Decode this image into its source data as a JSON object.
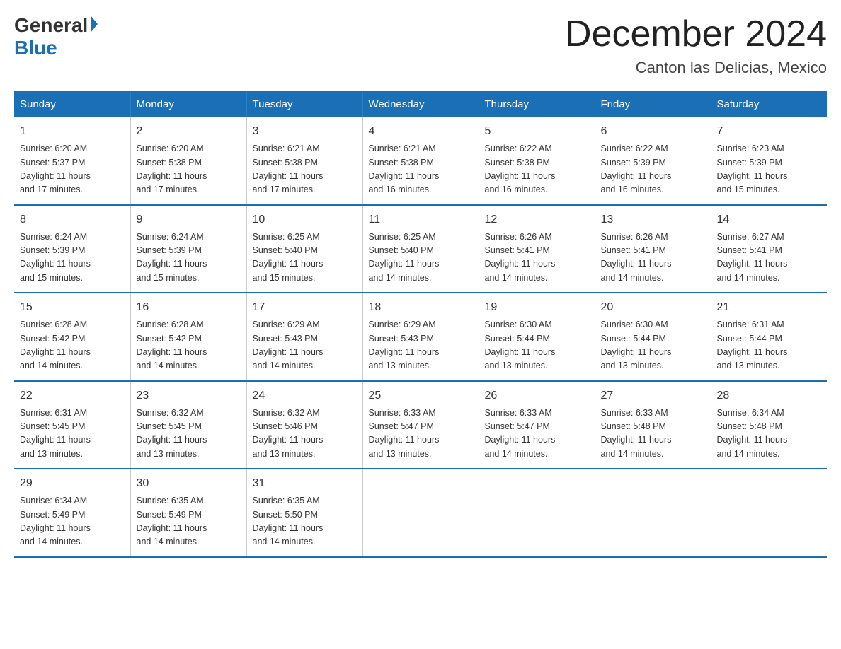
{
  "logo": {
    "general": "General",
    "blue": "Blue"
  },
  "title": "December 2024",
  "location": "Canton las Delicias, Mexico",
  "headers": [
    "Sunday",
    "Monday",
    "Tuesday",
    "Wednesday",
    "Thursday",
    "Friday",
    "Saturday"
  ],
  "weeks": [
    [
      {
        "day": "1",
        "sunrise": "6:20 AM",
        "sunset": "5:37 PM",
        "daylight": "11 hours and 17 minutes."
      },
      {
        "day": "2",
        "sunrise": "6:20 AM",
        "sunset": "5:38 PM",
        "daylight": "11 hours and 17 minutes."
      },
      {
        "day": "3",
        "sunrise": "6:21 AM",
        "sunset": "5:38 PM",
        "daylight": "11 hours and 17 minutes."
      },
      {
        "day": "4",
        "sunrise": "6:21 AM",
        "sunset": "5:38 PM",
        "daylight": "11 hours and 16 minutes."
      },
      {
        "day": "5",
        "sunrise": "6:22 AM",
        "sunset": "5:38 PM",
        "daylight": "11 hours and 16 minutes."
      },
      {
        "day": "6",
        "sunrise": "6:22 AM",
        "sunset": "5:39 PM",
        "daylight": "11 hours and 16 minutes."
      },
      {
        "day": "7",
        "sunrise": "6:23 AM",
        "sunset": "5:39 PM",
        "daylight": "11 hours and 15 minutes."
      }
    ],
    [
      {
        "day": "8",
        "sunrise": "6:24 AM",
        "sunset": "5:39 PM",
        "daylight": "11 hours and 15 minutes."
      },
      {
        "day": "9",
        "sunrise": "6:24 AM",
        "sunset": "5:39 PM",
        "daylight": "11 hours and 15 minutes."
      },
      {
        "day": "10",
        "sunrise": "6:25 AM",
        "sunset": "5:40 PM",
        "daylight": "11 hours and 15 minutes."
      },
      {
        "day": "11",
        "sunrise": "6:25 AM",
        "sunset": "5:40 PM",
        "daylight": "11 hours and 14 minutes."
      },
      {
        "day": "12",
        "sunrise": "6:26 AM",
        "sunset": "5:41 PM",
        "daylight": "11 hours and 14 minutes."
      },
      {
        "day": "13",
        "sunrise": "6:26 AM",
        "sunset": "5:41 PM",
        "daylight": "11 hours and 14 minutes."
      },
      {
        "day": "14",
        "sunrise": "6:27 AM",
        "sunset": "5:41 PM",
        "daylight": "11 hours and 14 minutes."
      }
    ],
    [
      {
        "day": "15",
        "sunrise": "6:28 AM",
        "sunset": "5:42 PM",
        "daylight": "11 hours and 14 minutes."
      },
      {
        "day": "16",
        "sunrise": "6:28 AM",
        "sunset": "5:42 PM",
        "daylight": "11 hours and 14 minutes."
      },
      {
        "day": "17",
        "sunrise": "6:29 AM",
        "sunset": "5:43 PM",
        "daylight": "11 hours and 14 minutes."
      },
      {
        "day": "18",
        "sunrise": "6:29 AM",
        "sunset": "5:43 PM",
        "daylight": "11 hours and 13 minutes."
      },
      {
        "day": "19",
        "sunrise": "6:30 AM",
        "sunset": "5:44 PM",
        "daylight": "11 hours and 13 minutes."
      },
      {
        "day": "20",
        "sunrise": "6:30 AM",
        "sunset": "5:44 PM",
        "daylight": "11 hours and 13 minutes."
      },
      {
        "day": "21",
        "sunrise": "6:31 AM",
        "sunset": "5:44 PM",
        "daylight": "11 hours and 13 minutes."
      }
    ],
    [
      {
        "day": "22",
        "sunrise": "6:31 AM",
        "sunset": "5:45 PM",
        "daylight": "11 hours and 13 minutes."
      },
      {
        "day": "23",
        "sunrise": "6:32 AM",
        "sunset": "5:45 PM",
        "daylight": "11 hours and 13 minutes."
      },
      {
        "day": "24",
        "sunrise": "6:32 AM",
        "sunset": "5:46 PM",
        "daylight": "11 hours and 13 minutes."
      },
      {
        "day": "25",
        "sunrise": "6:33 AM",
        "sunset": "5:47 PM",
        "daylight": "11 hours and 13 minutes."
      },
      {
        "day": "26",
        "sunrise": "6:33 AM",
        "sunset": "5:47 PM",
        "daylight": "11 hours and 14 minutes."
      },
      {
        "day": "27",
        "sunrise": "6:33 AM",
        "sunset": "5:48 PM",
        "daylight": "11 hours and 14 minutes."
      },
      {
        "day": "28",
        "sunrise": "6:34 AM",
        "sunset": "5:48 PM",
        "daylight": "11 hours and 14 minutes."
      }
    ],
    [
      {
        "day": "29",
        "sunrise": "6:34 AM",
        "sunset": "5:49 PM",
        "daylight": "11 hours and 14 minutes."
      },
      {
        "day": "30",
        "sunrise": "6:35 AM",
        "sunset": "5:49 PM",
        "daylight": "11 hours and 14 minutes."
      },
      {
        "day": "31",
        "sunrise": "6:35 AM",
        "sunset": "5:50 PM",
        "daylight": "11 hours and 14 minutes."
      },
      null,
      null,
      null,
      null
    ]
  ],
  "labels": {
    "sunrise": "Sunrise:",
    "sunset": "Sunset:",
    "daylight": "Daylight:"
  }
}
